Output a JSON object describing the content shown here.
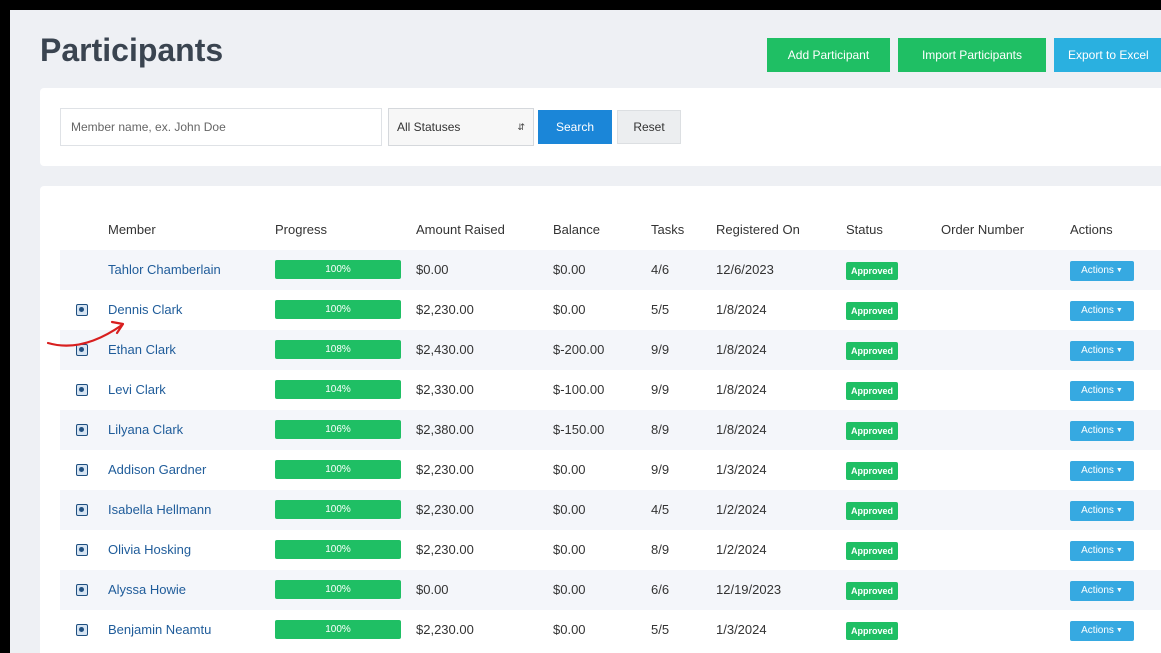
{
  "page": {
    "title": "Participants",
    "buttons": {
      "add": "Add Participant",
      "import": "Import Participants",
      "export": "Export to Excel"
    }
  },
  "filters": {
    "search_placeholder": "Member name, ex. John Doe",
    "search_value": "",
    "status_selected": "All Statuses",
    "search_label": "Search",
    "reset_label": "Reset"
  },
  "table": {
    "headers": {
      "member": "Member",
      "progress": "Progress",
      "amount_raised": "Amount Raised",
      "balance": "Balance",
      "tasks": "Tasks",
      "registered_on": "Registered On",
      "status": "Status",
      "order_number": "Order Number",
      "actions": "Actions"
    },
    "rows": [
      {
        "member": "Tahlor Chamberlain",
        "progress": "100%",
        "amount": "$0.00",
        "balance": "$0.00",
        "tasks": "4/6",
        "registered": "12/6/2023",
        "status": "Approved",
        "order": "",
        "actions": "Actions",
        "icon": ""
      },
      {
        "member": "Dennis Clark",
        "progress": "100%",
        "amount": "$2,230.00",
        "balance": "$0.00",
        "tasks": "5/5",
        "registered": "1/8/2024",
        "status": "Approved",
        "order": "",
        "actions": "Actions",
        "icon": "profile-icon"
      },
      {
        "member": "Ethan Clark",
        "progress": "108%",
        "amount": "$2,430.00",
        "balance": "$-200.00",
        "tasks": "9/9",
        "registered": "1/8/2024",
        "status": "Approved",
        "order": "",
        "actions": "Actions",
        "icon": "profile-icon"
      },
      {
        "member": "Levi Clark",
        "progress": "104%",
        "amount": "$2,330.00",
        "balance": "$-100.00",
        "tasks": "9/9",
        "registered": "1/8/2024",
        "status": "Approved",
        "order": "",
        "actions": "Actions",
        "icon": "profile-icon"
      },
      {
        "member": "Lilyana Clark",
        "progress": "106%",
        "amount": "$2,380.00",
        "balance": "$-150.00",
        "tasks": "8/9",
        "registered": "1/8/2024",
        "status": "Approved",
        "order": "",
        "actions": "Actions",
        "icon": "profile-icon"
      },
      {
        "member": "Addison Gardner",
        "progress": "100%",
        "amount": "$2,230.00",
        "balance": "$0.00",
        "tasks": "9/9",
        "registered": "1/3/2024",
        "status": "Approved",
        "order": "",
        "actions": "Actions",
        "icon": "profile-icon"
      },
      {
        "member": "Isabella Hellmann",
        "progress": "100%",
        "amount": "$2,230.00",
        "balance": "$0.00",
        "tasks": "4/5",
        "registered": "1/2/2024",
        "status": "Approved",
        "order": "",
        "actions": "Actions",
        "icon": "profile-icon"
      },
      {
        "member": "Olivia Hosking",
        "progress": "100%",
        "amount": "$2,230.00",
        "balance": "$0.00",
        "tasks": "8/9",
        "registered": "1/2/2024",
        "status": "Approved",
        "order": "",
        "actions": "Actions",
        "icon": "profile-icon"
      },
      {
        "member": "Alyssa Howie",
        "progress": "100%",
        "amount": "$0.00",
        "balance": "$0.00",
        "tasks": "6/6",
        "registered": "12/19/2023",
        "status": "Approved",
        "order": "",
        "actions": "Actions",
        "icon": "profile-icon"
      },
      {
        "member": "Benjamin Neamtu",
        "progress": "100%",
        "amount": "$2,230.00",
        "balance": "$0.00",
        "tasks": "5/5",
        "registered": "1/3/2024",
        "status": "Approved",
        "order": "",
        "actions": "Actions",
        "icon": "profile-icon"
      }
    ]
  },
  "colors": {
    "green": "#1fbf64",
    "blue": "#2ab0e0",
    "search_blue": "#1b86d8",
    "link": "#1f5c9a",
    "annotation": "#d81f1f"
  }
}
